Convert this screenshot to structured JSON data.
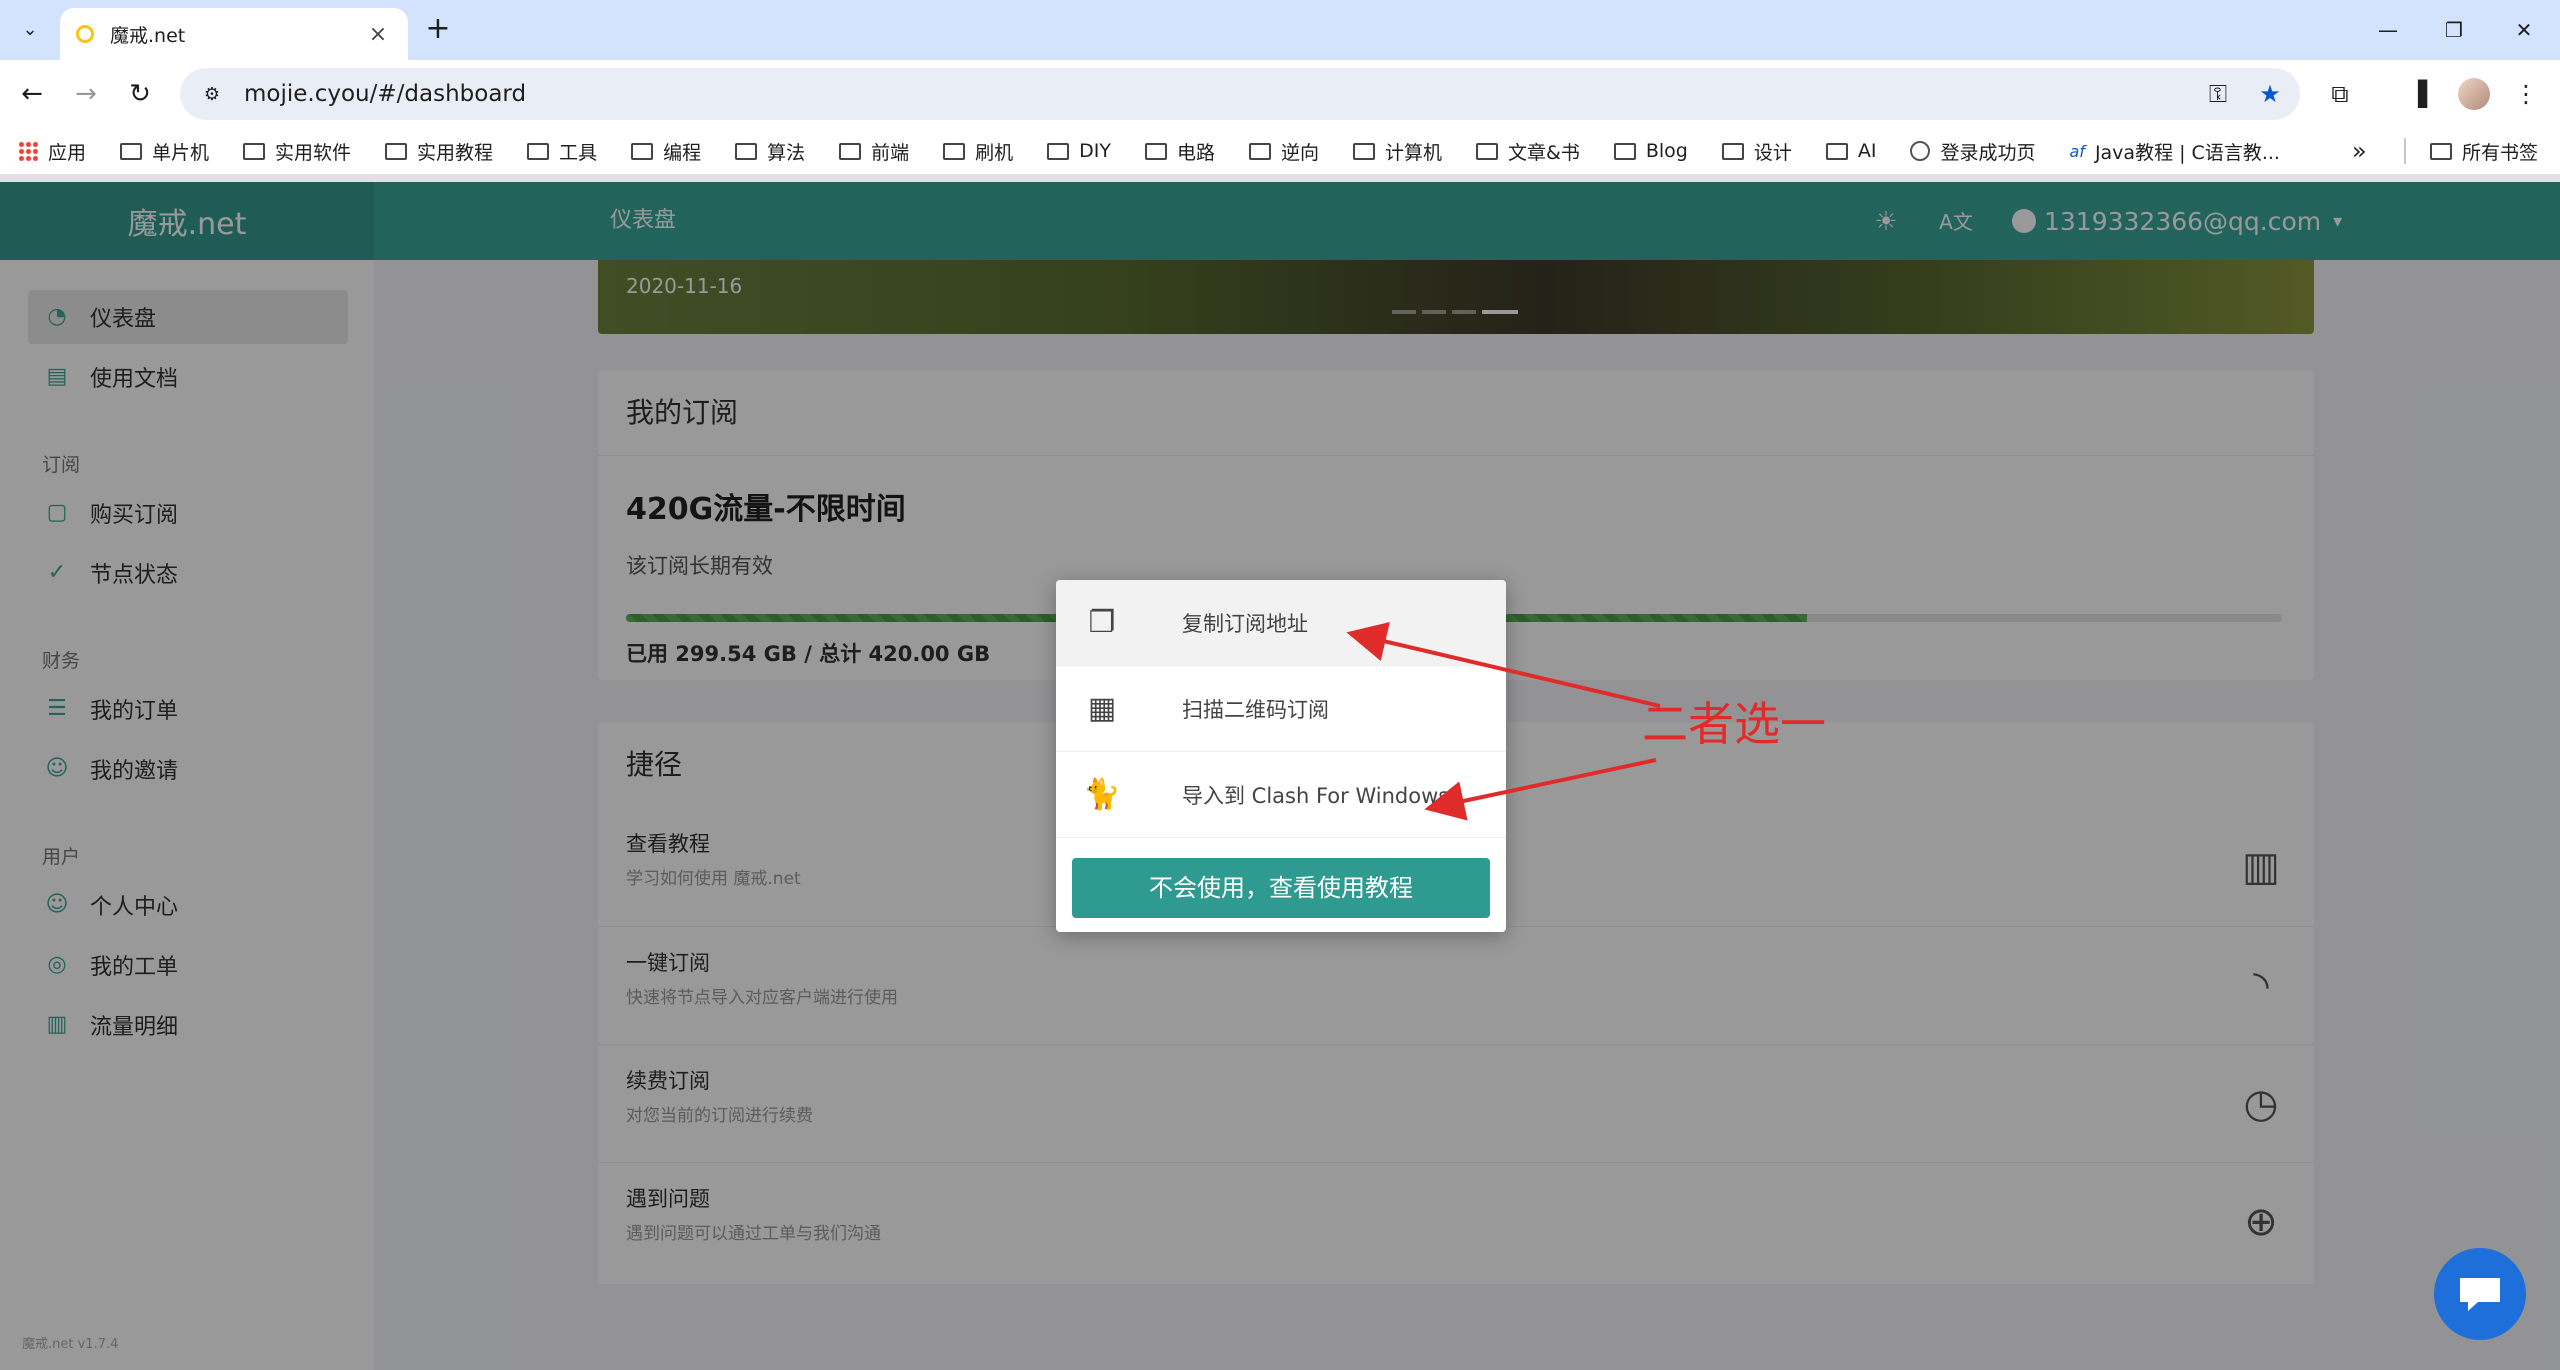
{
  "browser": {
    "tab_title": "魔戒.net",
    "url": "mojie.cyou/#/dashboard",
    "bookmarks": [
      {
        "label": "应用",
        "icon": "apps-grid-icon"
      },
      {
        "label": "单片机",
        "icon": "folder-icon"
      },
      {
        "label": "实用软件",
        "icon": "folder-icon"
      },
      {
        "label": "实用教程",
        "icon": "folder-icon"
      },
      {
        "label": "工具",
        "icon": "folder-icon"
      },
      {
        "label": "编程",
        "icon": "folder-icon"
      },
      {
        "label": "算法",
        "icon": "folder-icon"
      },
      {
        "label": "前端",
        "icon": "folder-icon"
      },
      {
        "label": "刷机",
        "icon": "folder-icon"
      },
      {
        "label": "DIY",
        "icon": "folder-icon"
      },
      {
        "label": "电路",
        "icon": "folder-icon"
      },
      {
        "label": "逆向",
        "icon": "folder-icon"
      },
      {
        "label": "计算机",
        "icon": "folder-icon"
      },
      {
        "label": "文章&书",
        "icon": "folder-icon"
      },
      {
        "label": "Blog",
        "icon": "folder-icon"
      },
      {
        "label": "设计",
        "icon": "folder-icon"
      },
      {
        "label": "AI",
        "icon": "folder-icon"
      },
      {
        "label": "登录成功页",
        "icon": "globe-icon"
      },
      {
        "label": "Java教程 | C语言教...",
        "icon": "af-icon"
      }
    ],
    "all_bookmarks": "所有书签"
  },
  "app": {
    "brand": "魔戒.net",
    "page_title": "仪表盘",
    "user_email": "1319332366@qq.com",
    "sidebar": {
      "items_top": [
        {
          "label": "仪表盘",
          "icon": "dashboard-icon"
        },
        {
          "label": "使用文档",
          "icon": "book-icon"
        }
      ],
      "group_subscribe": "订阅",
      "items_subscribe": [
        {
          "label": "购买订阅",
          "icon": "clipboard-icon"
        },
        {
          "label": "节点状态",
          "icon": "check-circle-icon"
        }
      ],
      "group_finance": "财务",
      "items_finance": [
        {
          "label": "我的订单",
          "icon": "list-icon"
        },
        {
          "label": "我的邀请",
          "icon": "users-icon"
        }
      ],
      "group_user": "用户",
      "items_user": [
        {
          "label": "个人中心",
          "icon": "user-icon"
        },
        {
          "label": "我的工单",
          "icon": "support-icon"
        },
        {
          "label": "流量明细",
          "icon": "bar-chart-icon"
        }
      ],
      "version": "魔戒.net v1.7.4"
    },
    "carousel": {
      "date": "2020-11-16"
    },
    "subscription": {
      "card_title": "我的订阅",
      "plan": "420G流量-不限时间",
      "validity": "该订阅长期有效",
      "usage_text": "已用 299.54 GB / 总计 420.00 GB",
      "used_fraction": 0.713
    },
    "shortcuts": {
      "card_title": "捷径",
      "items": [
        {
          "title": "查看教程",
          "desc": "学习如何使用 魔戒.net",
          "icon": "book-open-icon"
        },
        {
          "title": "一键订阅",
          "desc": "快速将节点导入对应客户端进行使用",
          "icon": "rss-icon"
        },
        {
          "title": "续费订阅",
          "desc": "对您当前的订阅进行续费",
          "icon": "clock-icon"
        },
        {
          "title": "遇到问题",
          "desc": "遇到问题可以通过工单与我们沟通",
          "icon": "lifebuoy-icon"
        }
      ]
    }
  },
  "modal": {
    "items": [
      {
        "label": "复制订阅地址",
        "icon": "copy-icon"
      },
      {
        "label": "扫描二维码订阅",
        "icon": "qrcode-icon"
      },
      {
        "label": "导入到 Clash For Windows",
        "icon": "cat-icon"
      }
    ],
    "button": "不会使用，查看使用教程"
  },
  "annotation": {
    "text": "二者选一",
    "color": "#e02b2b"
  }
}
